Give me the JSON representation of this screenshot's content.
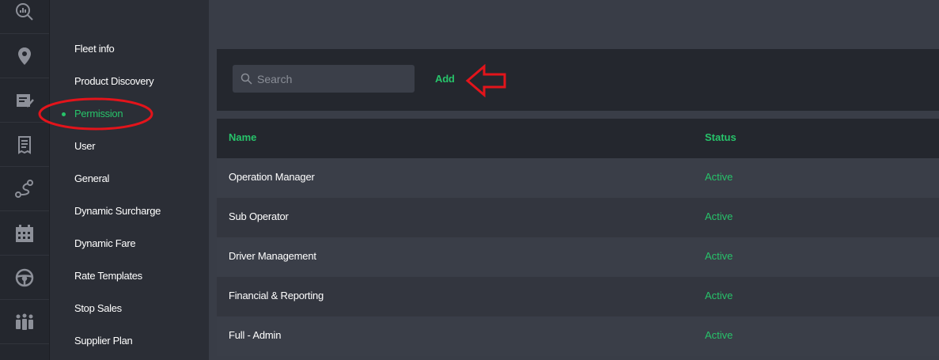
{
  "rail": {
    "icons": [
      "analytics-search-icon",
      "location-pin-icon",
      "checklist-icon",
      "receipt-icon",
      "route-icon",
      "calendar-icon",
      "steering-wheel-icon",
      "group-icon"
    ]
  },
  "submenu": {
    "items": [
      {
        "label": "Fleet info",
        "active": false
      },
      {
        "label": "Product Discovery",
        "active": false
      },
      {
        "label": "Permission",
        "active": true
      },
      {
        "label": "User",
        "active": false
      },
      {
        "label": "General",
        "active": false
      },
      {
        "label": "Dynamic Surcharge",
        "active": false
      },
      {
        "label": "Dynamic Fare",
        "active": false
      },
      {
        "label": "Rate Templates",
        "active": false
      },
      {
        "label": "Stop Sales",
        "active": false
      },
      {
        "label": "Supplier Plan",
        "active": false
      }
    ]
  },
  "toolbar": {
    "search_placeholder": "Search",
    "search_value": "",
    "add_label": "Add"
  },
  "table": {
    "columns": {
      "name": "Name",
      "status": "Status"
    },
    "rows": [
      {
        "name": "Operation Manager",
        "status": "Active"
      },
      {
        "name": "Sub Operator",
        "status": "Active"
      },
      {
        "name": "Driver Management",
        "status": "Active"
      },
      {
        "name": "Financial & Reporting",
        "status": "Active"
      },
      {
        "name": "Full - Admin",
        "status": "Active"
      }
    ]
  },
  "colors": {
    "accent": "#27c36a",
    "annotation": "#e3141b",
    "sidebar": "#24272e",
    "submenu": "#2b2e36",
    "content": "#393d47"
  }
}
